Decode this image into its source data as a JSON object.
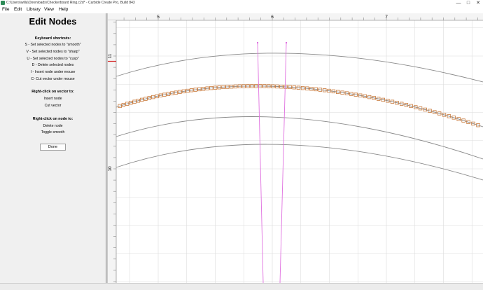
{
  "window": {
    "title": "C:\\Users\\willa\\Downloads\\Checkerboard Ring.c2d* - Carbide Create Pro, Build 843",
    "minimize_glyph": "—",
    "maximize_glyph": "□",
    "close_glyph": "✕"
  },
  "menu": {
    "items": [
      "File",
      "Edit",
      "Library",
      "View",
      "Help"
    ]
  },
  "panel": {
    "title": "Edit Nodes",
    "keyboard_heading": "Keyboard shortcuts:",
    "shortcuts": [
      "S - Set selected nodes to \"smooth\"",
      "V - Set selected nodes to \"sharp\"",
      "U - Set selected nodes to \"cusp\"",
      "D - Delete selected nodes",
      "I - Insert node under mouse",
      "C- Cut vector under mouse"
    ],
    "vector_heading": "Right-click on vector to:",
    "vector_actions": [
      "Insert node",
      "Cut vector"
    ],
    "node_heading": "Right-click on node to:",
    "node_actions": [
      "Delete node",
      "Toggle smooth"
    ],
    "done_label": "Done"
  },
  "ruler": {
    "x_labels": [
      "5",
      "6",
      "7"
    ],
    "y_labels": [
      "11",
      "10"
    ]
  },
  "colors": {
    "vector": "#8a8a8a",
    "selected_node": "#c97a3c",
    "toolpath": "#e070e0",
    "ruler_marker": "#d32020",
    "grid": "#dcdcdc"
  },
  "icons": {
    "app": "carbide-create-icon"
  }
}
